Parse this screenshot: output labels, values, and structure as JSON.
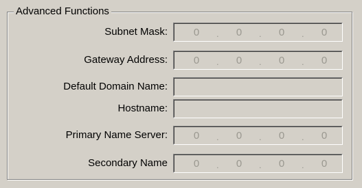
{
  "group": {
    "title": "Advanced Functions"
  },
  "fields": {
    "subnet_mask": {
      "label": "Subnet Mask:",
      "octets": [
        "0",
        "0",
        "0",
        "0"
      ],
      "separator": "."
    },
    "gateway_address": {
      "label": "Gateway Address:",
      "octets": [
        "0",
        "0",
        "0",
        "0"
      ],
      "separator": "."
    },
    "default_domain_name": {
      "label": "Default Domain Name:",
      "value": ""
    },
    "hostname": {
      "label": "Hostname:",
      "value": ""
    },
    "primary_name_server": {
      "label": "Primary Name Server:",
      "octets": [
        "0",
        "0",
        "0",
        "0"
      ],
      "separator": "."
    },
    "secondary_name": {
      "label": "Secondary Name",
      "octets": [
        "0",
        "0",
        "0",
        "0"
      ],
      "separator": "."
    }
  },
  "colors": {
    "window_bg": "#d4d0c8",
    "disabled_text": "#9a9890",
    "shadow": "#808080",
    "highlight": "#ffffff"
  }
}
